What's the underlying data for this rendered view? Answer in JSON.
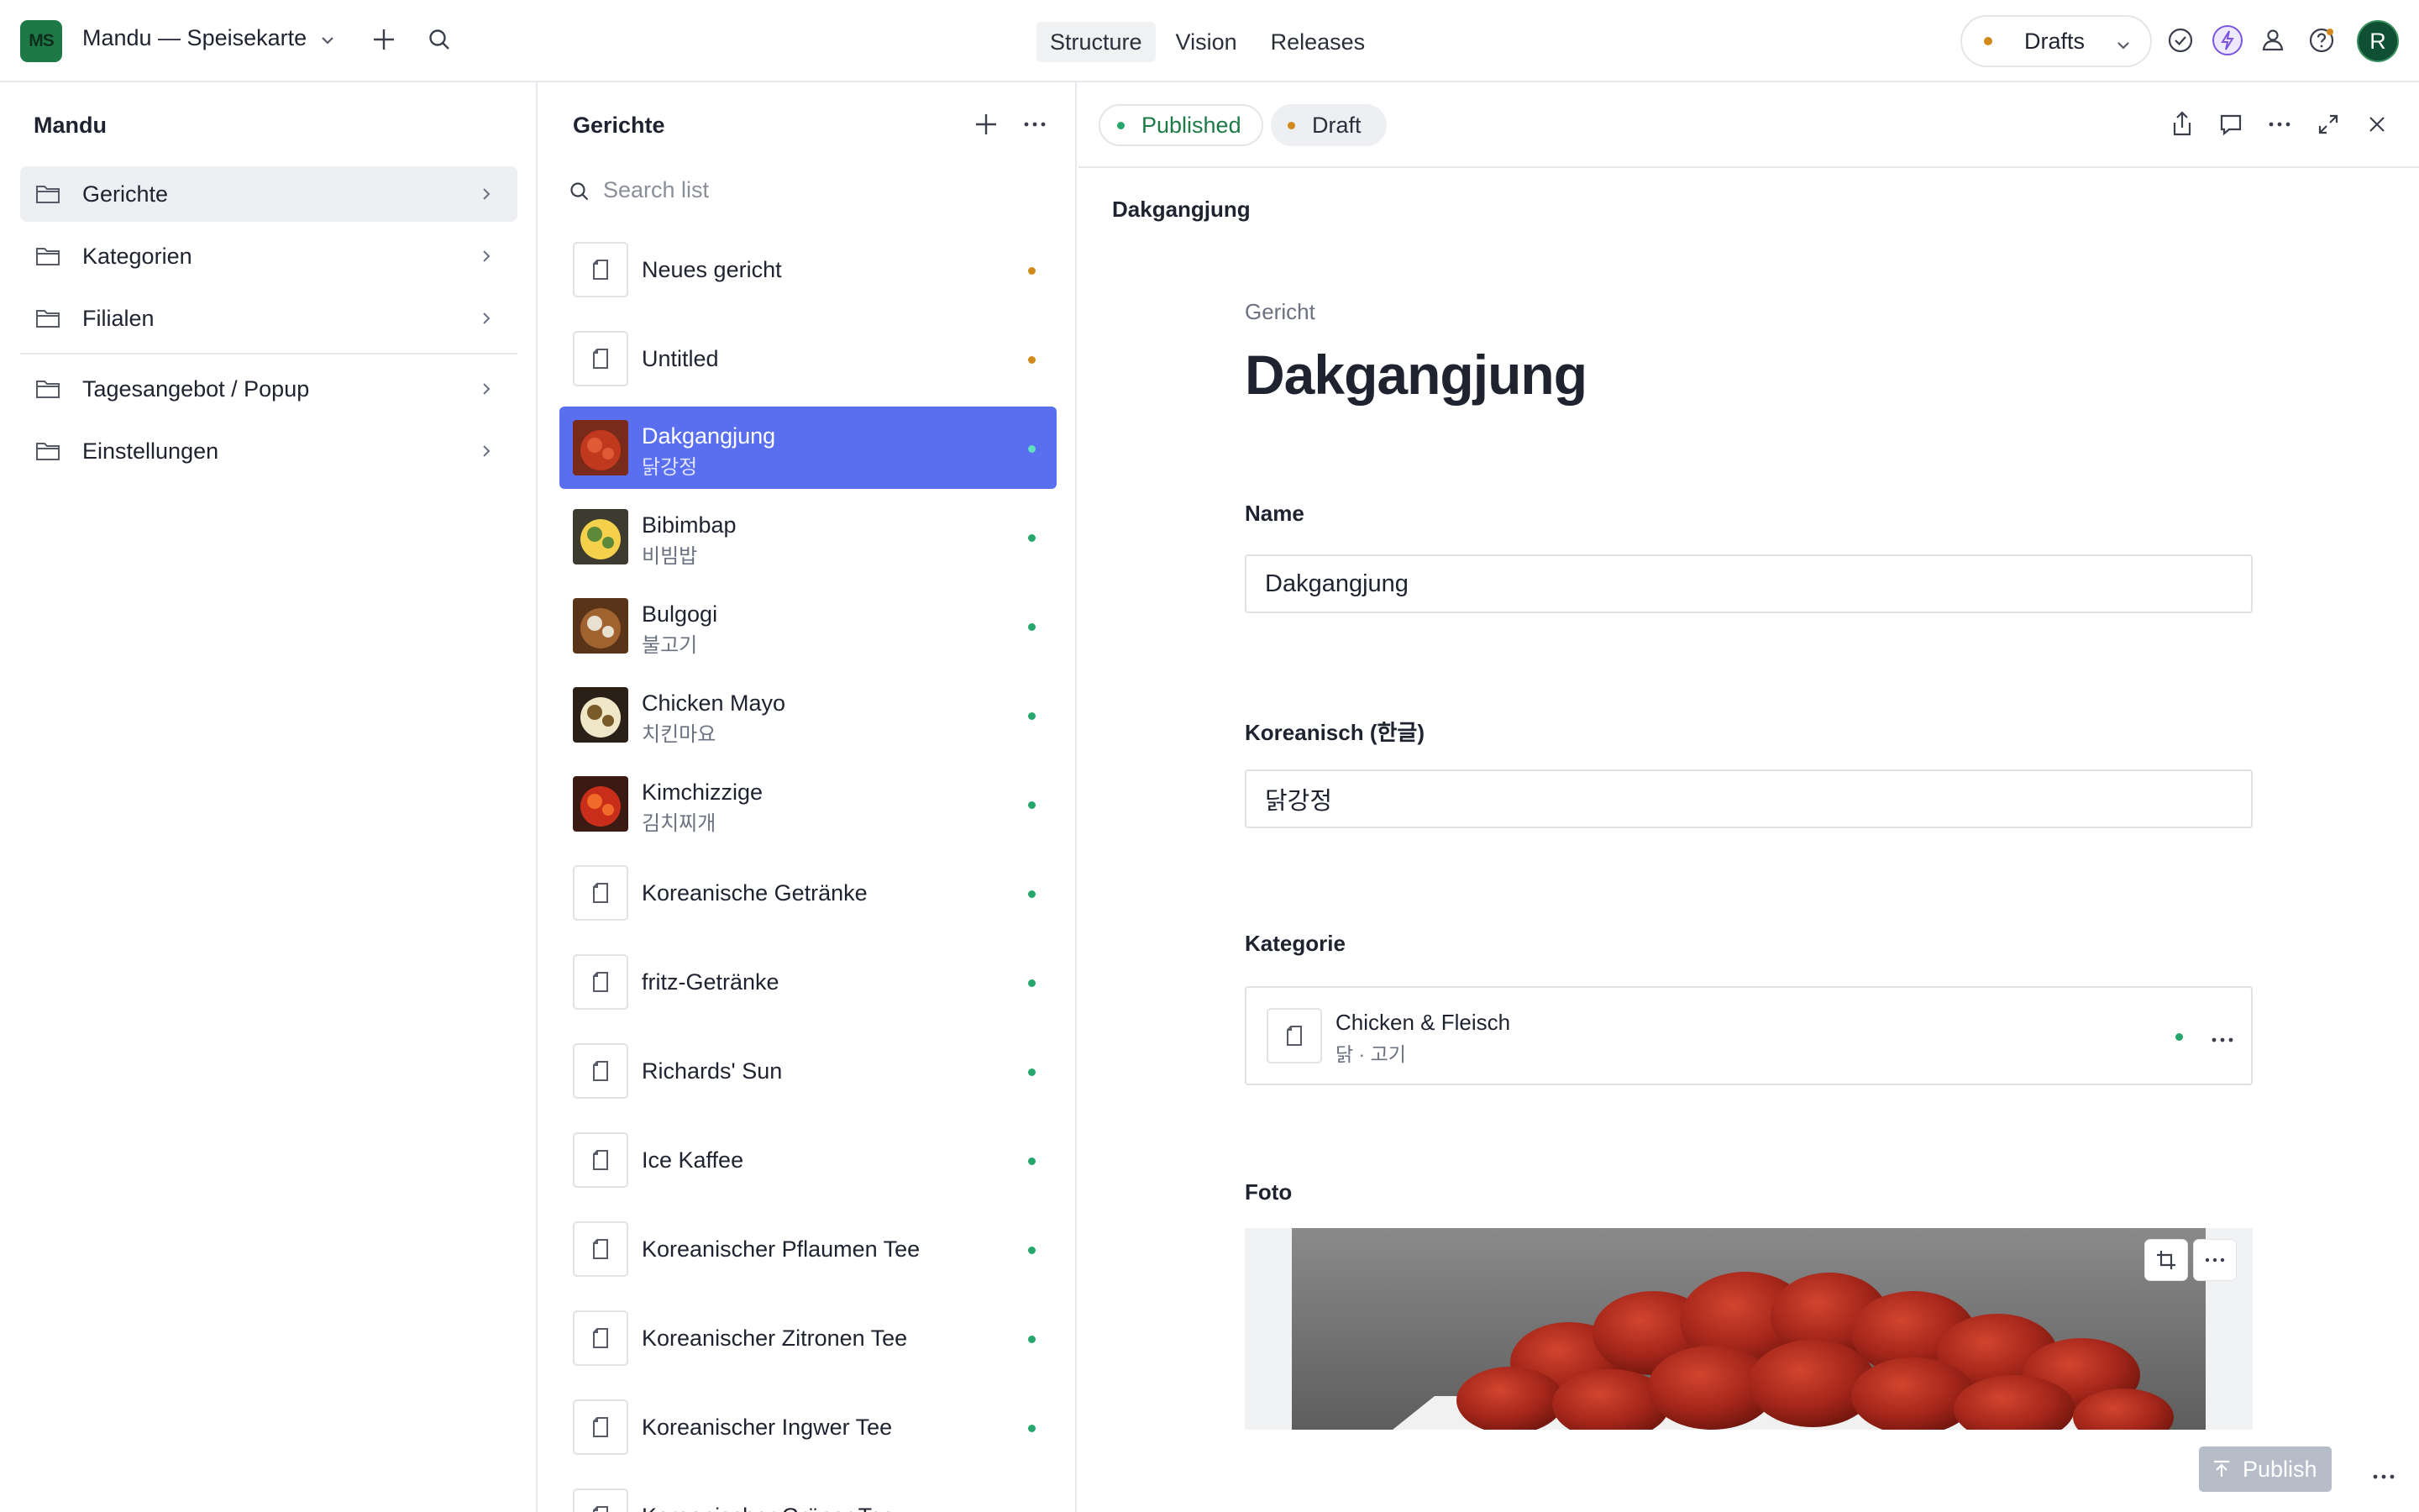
{
  "topbar": {
    "workspace_initials": "MS",
    "workspace_name": "Mandu — Speisekarte",
    "tabs": [
      {
        "label": "Structure",
        "active": true
      },
      {
        "label": "Vision",
        "active": false
      },
      {
        "label": "Releases",
        "active": false
      }
    ],
    "perspective": {
      "label": "Drafts",
      "dot_color": "#d38a1d"
    },
    "avatar_initial": "R",
    "icons": [
      "plus-icon",
      "search-icon",
      "chevron-down-icon",
      "check-circle-icon",
      "bolt-icon",
      "presence-icon",
      "help-icon"
    ]
  },
  "structure": {
    "title": "Mandu",
    "items": [
      {
        "label": "Gerichte",
        "selected": true
      },
      {
        "label": "Kategorien",
        "selected": false
      },
      {
        "label": "Filialen",
        "selected": false
      },
      {
        "label": "Tagesangebot / Popup",
        "selected": false
      },
      {
        "label": "Einstellungen",
        "selected": false
      }
    ]
  },
  "list": {
    "title": "Gerichte",
    "search_placeholder": "Search list",
    "items": [
      {
        "title": "Neues gericht",
        "subtitle": "",
        "media": "doc",
        "status": "draft"
      },
      {
        "title": "Untitled",
        "subtitle": "",
        "media": "doc",
        "status": "draft"
      },
      {
        "title": "Dakgangjung",
        "subtitle": "닭강정",
        "media": "photo",
        "status": "published",
        "selected": true
      },
      {
        "title": "Bibimbap",
        "subtitle": "비빔밥",
        "media": "photo",
        "status": "published"
      },
      {
        "title": "Bulgogi",
        "subtitle": "불고기",
        "media": "photo",
        "status": "published"
      },
      {
        "title": "Chicken Mayo",
        "subtitle": "치킨마요",
        "media": "photo",
        "status": "published"
      },
      {
        "title": "Kimchizzige",
        "subtitle": "김치찌개",
        "media": "photo",
        "status": "published"
      },
      {
        "title": "Koreanische Getränke",
        "subtitle": "",
        "media": "doc",
        "status": "published"
      },
      {
        "title": "fritz-Getränke",
        "subtitle": "",
        "media": "doc",
        "status": "published"
      },
      {
        "title": "Richards' Sun",
        "subtitle": "",
        "media": "doc",
        "status": "published"
      },
      {
        "title": "Ice Kaffee",
        "subtitle": "",
        "media": "doc",
        "status": "published"
      },
      {
        "title": "Koreanischer Pflaumen Tee",
        "subtitle": "",
        "media": "doc",
        "status": "published"
      },
      {
        "title": "Koreanischer Zitronen Tee",
        "subtitle": "",
        "media": "doc",
        "status": "published"
      },
      {
        "title": "Koreanischer Ingwer Tee",
        "subtitle": "",
        "media": "doc",
        "status": "published"
      },
      {
        "title": "Koreanischer Grüner Tee",
        "subtitle": "",
        "media": "doc",
        "status": "published"
      }
    ],
    "status_colors": {
      "draft": "#d38a1d",
      "published": "#25a76b"
    }
  },
  "editor": {
    "status_published": "Published",
    "status_draft": "Draft",
    "breadcrumb": "Dakgangjung",
    "doc_type": "Gericht",
    "doc_title": "Dakgangjung",
    "fields": {
      "name_label": "Name",
      "name_value": "Dakgangjung",
      "korean_label": "Koreanisch (한글)",
      "korean_value": "닭강정",
      "category_label": "Kategorie",
      "category_title": "Chicken & Fleisch",
      "category_subtitle": "닭 · 고기",
      "photo_label": "Foto"
    },
    "publish_label": "Publish"
  },
  "colors": {
    "accent": "#5a6ff0",
    "brand": "#1d7a47"
  }
}
